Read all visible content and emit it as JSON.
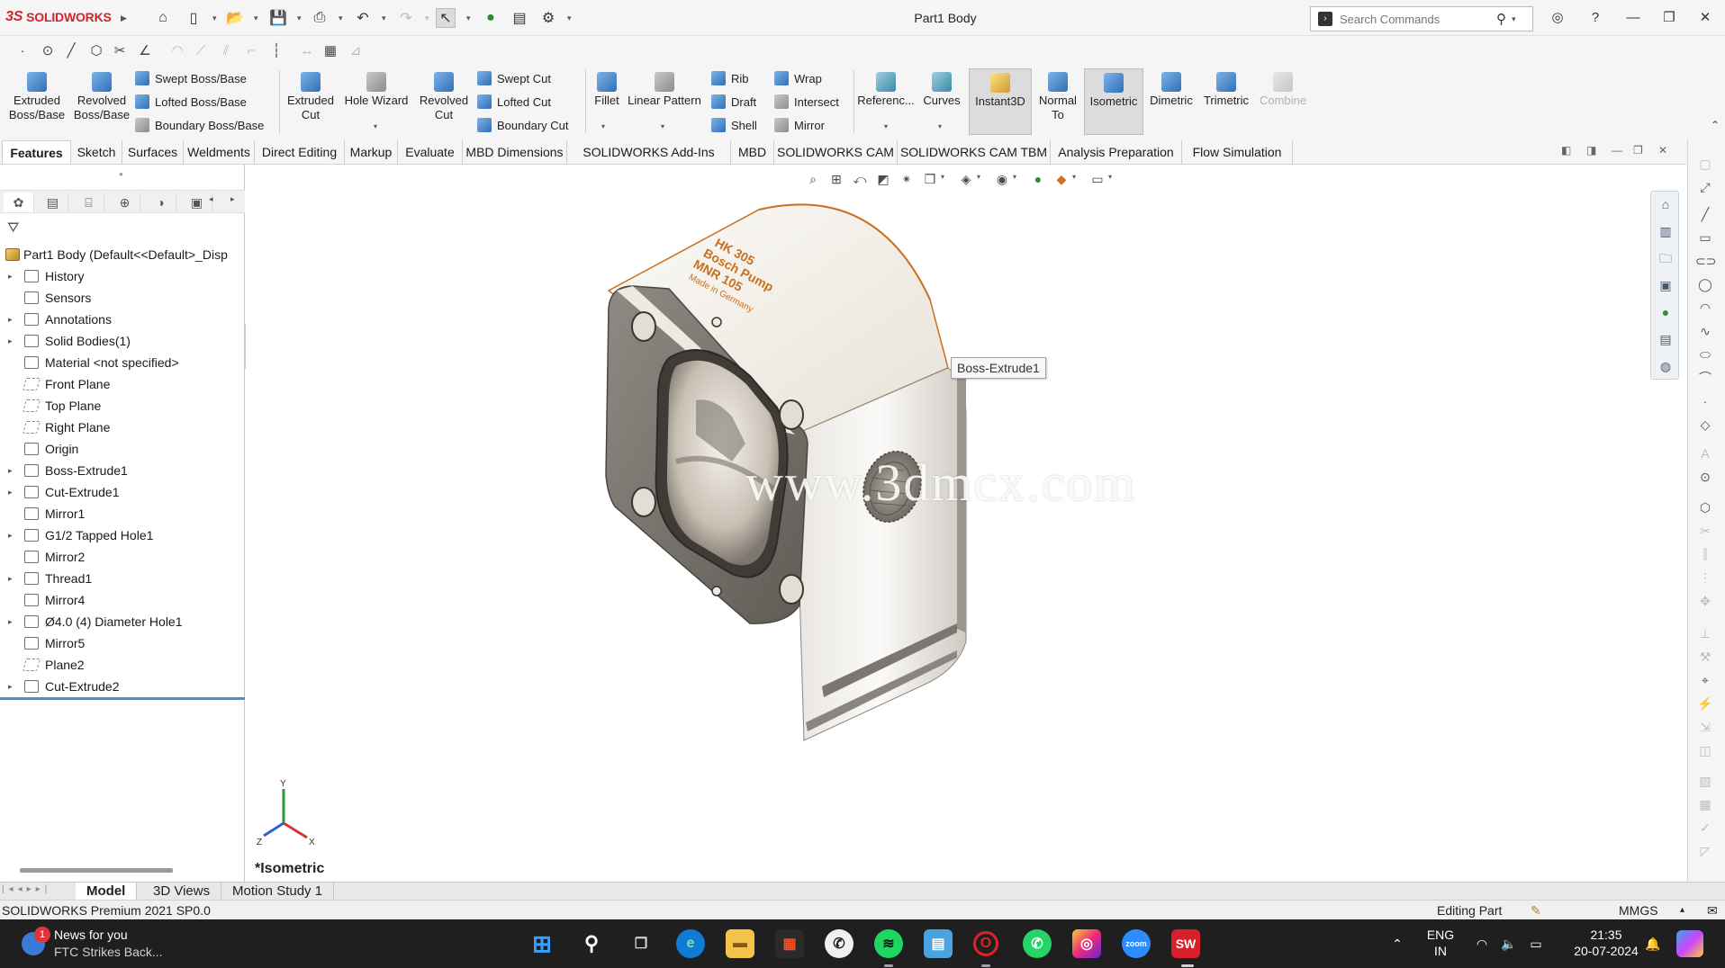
{
  "app": {
    "name": "SOLIDWORKS",
    "document_title": "Part1 Body",
    "search_placeholder": "Search Commands"
  },
  "ribbon": {
    "extruded_boss": "Extruded Boss/Base",
    "revolved_boss": "Revolved Boss/Base",
    "swept_boss": "Swept Boss/Base",
    "lofted_boss": "Lofted Boss/Base",
    "boundary_boss": "Boundary Boss/Base",
    "extruded_cut": "Extruded Cut",
    "hole_wizard": "Hole Wizard",
    "revolved_cut": "Revolved Cut",
    "swept_cut": "Swept Cut",
    "lofted_cut": "Lofted Cut",
    "boundary_cut": "Boundary Cut",
    "fillet": "Fillet",
    "linear_pattern": "Linear Pattern",
    "rib": "Rib",
    "draft": "Draft",
    "shell": "Shell",
    "wrap": "Wrap",
    "intersect": "Intersect",
    "mirror": "Mirror",
    "reference": "Referenc...",
    "curves": "Curves",
    "instant3d": "Instant3D",
    "normal_to": "Normal To",
    "isometric": "Isometric",
    "dimetric": "Dimetric",
    "trimetric": "Trimetric",
    "combine": "Combine"
  },
  "tabs": [
    {
      "label": "Features",
      "active": true
    },
    {
      "label": "Sketch"
    },
    {
      "label": "Surfaces"
    },
    {
      "label": "Weldments"
    },
    {
      "label": "Direct Editing"
    },
    {
      "label": "Markup"
    },
    {
      "label": "Evaluate"
    },
    {
      "label": "MBD Dimensions"
    },
    {
      "label": "SOLIDWORKS Add-Ins"
    },
    {
      "label": "MBD"
    },
    {
      "label": "SOLIDWORKS CAM"
    },
    {
      "label": "SOLIDWORKS CAM TBM"
    },
    {
      "label": "Analysis Preparation"
    },
    {
      "label": "Flow Simulation"
    }
  ],
  "tree": {
    "root": "Part1 Body  (Default<<Default>_Disp",
    "items": [
      {
        "label": "History",
        "expandable": true
      },
      {
        "label": "Sensors"
      },
      {
        "label": "Annotations",
        "expandable": true
      },
      {
        "label": "Solid Bodies(1)",
        "expandable": true
      },
      {
        "label": "Material <not specified>"
      },
      {
        "label": "Front Plane"
      },
      {
        "label": "Top Plane"
      },
      {
        "label": "Right Plane"
      },
      {
        "label": "Origin"
      },
      {
        "label": "Boss-Extrude1",
        "expandable": true
      },
      {
        "label": "Cut-Extrude1",
        "expandable": true
      },
      {
        "label": "Mirror1"
      },
      {
        "label": "G1/2 Tapped Hole1",
        "expandable": true
      },
      {
        "label": "Mirror2"
      },
      {
        "label": "Thread1",
        "expandable": true
      },
      {
        "label": "Mirror4"
      },
      {
        "label": "Ø4.0 (4) Diameter Hole1",
        "expandable": true
      },
      {
        "label": "Mirror5"
      },
      {
        "label": "Plane2"
      },
      {
        "label": "Cut-Extrude2",
        "expandable": true
      }
    ]
  },
  "viewport": {
    "tooltip": "Boss-Extrude1",
    "watermark": "www.3dmcx.com",
    "engraving": [
      "HK 305",
      "Bosch Pump",
      "MNR 105",
      "Made in Germany"
    ],
    "view_label": "*Isometric",
    "axis_x": "X",
    "axis_y": "Y",
    "axis_z": "Z",
    "accent_color": "#c8701e"
  },
  "bottom_tabs": [
    {
      "label": "Model",
      "active": true
    },
    {
      "label": "3D Views"
    },
    {
      "label": "Motion Study 1"
    }
  ],
  "status": {
    "version": "SOLIDWORKS Premium 2021 SP0.0",
    "mode": "Editing Part",
    "units": "MMGS"
  },
  "taskbar": {
    "news_title": "News for you",
    "news_subtitle": "FTC Strikes Back...",
    "news_badge": "1",
    "lang_top": "ENG",
    "lang_bottom": "IN",
    "time": "21:35",
    "date": "20-07-2024"
  }
}
